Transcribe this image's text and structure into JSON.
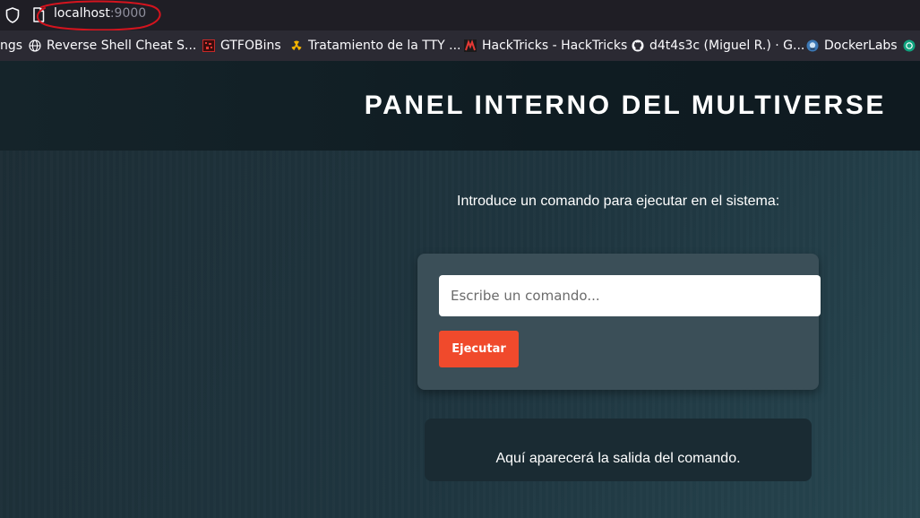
{
  "browser": {
    "url_host": "localhost",
    "url_port": ":9000",
    "bookmarks": [
      {
        "label": "ngs",
        "icon": "none"
      },
      {
        "label": "Reverse Shell Cheat S...",
        "icon": "globe-icon"
      },
      {
        "label": "GTFOBins",
        "icon": "gtfobins-icon"
      },
      {
        "label": "Tratamiento de la TTY ...",
        "icon": "radiation-icon"
      },
      {
        "label": "HackTricks - HackTricks",
        "icon": "hacktricks-icon"
      },
      {
        "label": "d4t4s3c (Miguel R.) · G...",
        "icon": "github-icon"
      },
      {
        "label": "DockerLabs",
        "icon": "dockerlabs-icon"
      }
    ]
  },
  "header": {
    "title": "PANEL INTERNO DEL MULTIVERSE"
  },
  "main": {
    "instruction": "Introduce un comando para ejecutar en el sistema:",
    "input_placeholder": "Escribe un comando...",
    "execute_label": "Ejecutar",
    "output_text": "Aquí aparecerá la salida del comando."
  },
  "colors": {
    "accent": "#f04a2c",
    "header_bg": "#0f1c22",
    "card_bg": "#3b4f58",
    "annotation": "#d4141e"
  }
}
